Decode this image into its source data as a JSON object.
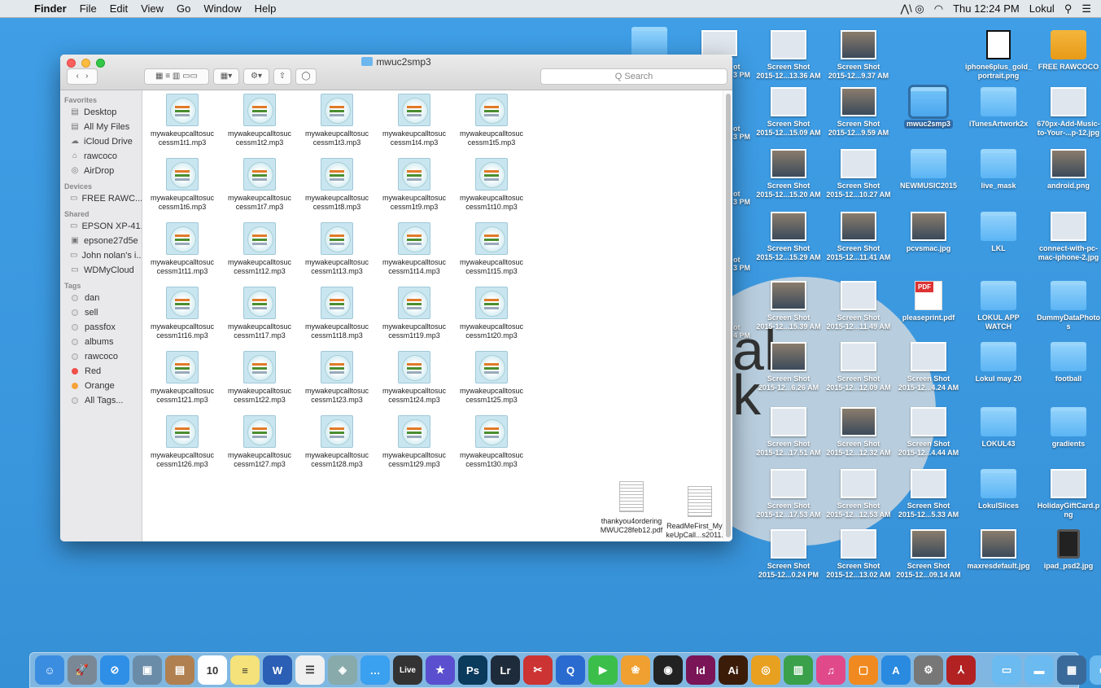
{
  "menubar": {
    "apple": "",
    "items": [
      "Finder",
      "File",
      "Edit",
      "View",
      "Go",
      "Window",
      "Help"
    ],
    "clock": "Thu 12:24 PM",
    "user": "Lokul"
  },
  "window": {
    "title": "mwuc2smp3",
    "search_placeholder": "Q Search"
  },
  "sidebar": {
    "favorites_header": "Favorites",
    "favorites": [
      "Desktop",
      "All My Files",
      "iCloud Drive",
      "rawcoco",
      "AirDrop"
    ],
    "devices_header": "Devices",
    "devices": [
      "FREE RAWC... ≜"
    ],
    "shared_header": "Shared",
    "shared": [
      "EPSON XP-41...",
      "epsone27d5e",
      "John nolan's i...",
      "WDMyCloud"
    ],
    "tags_header": "Tags",
    "tags": [
      {
        "label": "dan",
        "color": "#dddddd"
      },
      {
        "label": "sell",
        "color": "#dddddd"
      },
      {
        "label": "passfox",
        "color": "#dddddd"
      },
      {
        "label": "albums",
        "color": "#dddddd"
      },
      {
        "label": "rawcoco",
        "color": "#dddddd"
      },
      {
        "label": "Red",
        "color": "#f0504a"
      },
      {
        "label": "Orange",
        "color": "#f6a33a"
      },
      {
        "label": "All Tags...",
        "color": "#dddddd"
      }
    ]
  },
  "files": [
    {
      "l1": "mywakeupcalltosuc",
      "l2": "cessm1t1.mp3"
    },
    {
      "l1": "mywakeupcalltosuc",
      "l2": "cessm1t2.mp3"
    },
    {
      "l1": "mywakeupcalltosuc",
      "l2": "cessm1t3.mp3"
    },
    {
      "l1": "mywakeupcalltosuc",
      "l2": "cessm1t4.mp3"
    },
    {
      "l1": "mywakeupcalltosuc",
      "l2": "cessm1t5.mp3"
    },
    {
      "l1": "mywakeupcalltosuc",
      "l2": "cessm1t6.mp3"
    },
    {
      "l1": "mywakeupcalltosuc",
      "l2": "cessm1t7.mp3"
    },
    {
      "l1": "mywakeupcalltosuc",
      "l2": "cessm1t8.mp3"
    },
    {
      "l1": "mywakeupcalltosuc",
      "l2": "cessm1t9.mp3"
    },
    {
      "l1": "mywakeupcalltosuc",
      "l2": "cessm1t10.mp3"
    },
    {
      "l1": "mywakeupcalltosuc",
      "l2": "cessm1t11.mp3"
    },
    {
      "l1": "mywakeupcalltosuc",
      "l2": "cessm1t12.mp3"
    },
    {
      "l1": "mywakeupcalltosuc",
      "l2": "cessm1t13.mp3"
    },
    {
      "l1": "mywakeupcalltosuc",
      "l2": "cessm1t14.mp3"
    },
    {
      "l1": "mywakeupcalltosuc",
      "l2": "cessm1t15.mp3"
    },
    {
      "l1": "mywakeupcalltosuc",
      "l2": "cessm1t16.mp3"
    },
    {
      "l1": "mywakeupcalltosuc",
      "l2": "cessm1t17.mp3"
    },
    {
      "l1": "mywakeupcalltosuc",
      "l2": "cessm1t18.mp3"
    },
    {
      "l1": "mywakeupcalltosuc",
      "l2": "cessm1t19.mp3"
    },
    {
      "l1": "mywakeupcalltosuc",
      "l2": "cessm1t20.mp3"
    },
    {
      "l1": "mywakeupcalltosuc",
      "l2": "cessm1t21.mp3"
    },
    {
      "l1": "mywakeupcalltosuc",
      "l2": "cessm1t22.mp3"
    },
    {
      "l1": "mywakeupcalltosuc",
      "l2": "cessm1t23.mp3"
    },
    {
      "l1": "mywakeupcalltosuc",
      "l2": "cessm1t24.mp3"
    },
    {
      "l1": "mywakeupcalltosuc",
      "l2": "cessm1t25.mp3"
    },
    {
      "l1": "mywakeupcalltosuc",
      "l2": "cessm1t26.mp3"
    },
    {
      "l1": "mywakeupcalltosuc",
      "l2": "cessm1t27.mp3"
    },
    {
      "l1": "mywakeupcalltosuc",
      "l2": "cessm1t28.mp3"
    },
    {
      "l1": "mywakeupcalltosuc",
      "l2": "cessm1t29.mp3"
    },
    {
      "l1": "mywakeupcalltosuc",
      "l2": "cessm1t30.mp3"
    }
  ],
  "pdfs": [
    {
      "l1": "thankyou4ordering",
      "l2": "MWUC28feb12.pdf"
    },
    {
      "l1": "ReadMeFirst_MyWa",
      "l2": "keUpCall...s2011.pdf"
    }
  ],
  "desktop_icons": [
    {
      "l1": "Screen Shot",
      "l2": "2015-12...13.36 AM",
      "kind": "shot"
    },
    {
      "l1": "Screen Shot",
      "l2": "2015-12...9.37 AM",
      "kind": "shot dark"
    },
    {
      "l1": "iphone6plus_gold_",
      "l2": "portrait.png",
      "kind": "phone"
    },
    {
      "l1": "FREE RAWCOCO",
      "l2": "",
      "kind": "drive"
    },
    {
      "l1": "Screen Shot",
      "l2": "2015-12...15.09 AM",
      "kind": "shot"
    },
    {
      "l1": "Screen Shot",
      "l2": "2015-12...9.59 AM",
      "kind": "shot dark"
    },
    {
      "l1": "mwuc2smp3",
      "l2": "",
      "kind": "folder selected"
    },
    {
      "l1": "iTunesArtwork2x",
      "l2": "",
      "kind": "folder"
    },
    {
      "l1": "670px-Add-Music-",
      "l2": "to-Your-...p-12.jpg",
      "kind": "shot"
    },
    {
      "l1": "Screen Shot",
      "l2": "2015-12...15.20 AM",
      "kind": "shot dark"
    },
    {
      "l1": "Screen Shot",
      "l2": "2015-12...10.27 AM",
      "kind": "shot"
    },
    {
      "l1": "NEWMUSIC2015",
      "l2": "",
      "kind": "folder"
    },
    {
      "l1": "live_mask",
      "l2": "",
      "kind": "folder"
    },
    {
      "l1": "android.png",
      "l2": "",
      "kind": "shot dark"
    },
    {
      "l1": "Screen Shot",
      "l2": "2015-12...15.29 AM",
      "kind": "shot dark"
    },
    {
      "l1": "Screen Shot",
      "l2": "2015-12...11.41 AM",
      "kind": "shot dark"
    },
    {
      "l1": "pcvsmac.jpg",
      "l2": "",
      "kind": "shot dark"
    },
    {
      "l1": "LKL",
      "l2": "",
      "kind": "folder"
    },
    {
      "l1": "connect-with-pc-",
      "l2": "mac-iphone-2.jpg",
      "kind": "shot"
    },
    {
      "l1": "Screen Shot",
      "l2": "2015-12...15.39 AM",
      "kind": "shot dark"
    },
    {
      "l1": "Screen Shot",
      "l2": "2015-12...11.49 AM",
      "kind": "shot"
    },
    {
      "l1": "pleaseprint.pdf",
      "l2": "",
      "kind": "pdf"
    },
    {
      "l1": "LOKUL APP",
      "l2": "WATCH",
      "kind": "folder"
    },
    {
      "l1": "DummyDataPhoto",
      "l2": "s",
      "kind": "folder"
    },
    {
      "l1": "Screen Shot",
      "l2": "2015-12...6.26 AM",
      "kind": "shot dark"
    },
    {
      "l1": "Screen Shot",
      "l2": "2015-12...12.09 AM",
      "kind": "shot"
    },
    {
      "l1": "Screen Shot",
      "l2": "2015-12...4.24 AM",
      "kind": "shot"
    },
    {
      "l1": "Lokul may 20",
      "l2": "",
      "kind": "folder"
    },
    {
      "l1": "football",
      "l2": "",
      "kind": "folder"
    },
    {
      "l1": "Screen Shot",
      "l2": "2015-12...17.51 AM",
      "kind": "shot"
    },
    {
      "l1": "Screen Shot",
      "l2": "2015-12...12.32 AM",
      "kind": "shot dark"
    },
    {
      "l1": "Screen Shot",
      "l2": "2015-12...4.44 AM",
      "kind": "shot"
    },
    {
      "l1": "LOKUL43",
      "l2": "",
      "kind": "folder"
    },
    {
      "l1": "gradients",
      "l2": "",
      "kind": "folder"
    },
    {
      "l1": "Screen Shot",
      "l2": "2015-12...17.53 AM",
      "kind": "shot"
    },
    {
      "l1": "Screen Shot",
      "l2": "2015-12...12.53 AM",
      "kind": "shot"
    },
    {
      "l1": "Screen Shot",
      "l2": "2015-12...5.33 AM",
      "kind": "shot"
    },
    {
      "l1": "LokulSlices",
      "l2": "",
      "kind": "folder"
    },
    {
      "l1": "HolidayGiftCard.p",
      "l2": "ng",
      "kind": "shot"
    },
    {
      "l1": "Screen Shot",
      "l2": "2015-12...0.24 PM",
      "kind": "shot"
    },
    {
      "l1": "Screen Shot",
      "l2": "2015-12...13.02 AM",
      "kind": "shot"
    },
    {
      "l1": "Screen Shot",
      "l2": "2015-12...09.14 AM",
      "kind": "shot dark"
    },
    {
      "l1": "maxresdefault.jpg",
      "l2": "",
      "kind": "shot dark"
    },
    {
      "l1": "ipad_psd2.jpg",
      "l2": "",
      "kind": "ipad"
    }
  ],
  "partial_labels": [
    "ot",
    "3 PM",
    "ot",
    "3 PM",
    "ot",
    "3 PM",
    "ot",
    "3 PM",
    "ot",
    "4 PM"
  ],
  "dock": [
    {
      "name": "finder-icon",
      "glyph": "☺",
      "color": "#3b8de0"
    },
    {
      "name": "launchpad-icon",
      "glyph": "🚀",
      "color": "#7a8896"
    },
    {
      "name": "safari-icon",
      "glyph": "⊘",
      "color": "#2f8fe6"
    },
    {
      "name": "preview-icon",
      "glyph": "▣",
      "color": "#6b8ca8"
    },
    {
      "name": "contacts-icon",
      "glyph": "▤",
      "color": "#b08050"
    },
    {
      "name": "calendar-icon",
      "glyph": "10",
      "color": "#ffffff"
    },
    {
      "name": "notes-icon",
      "glyph": "≡",
      "color": "#f5e27a"
    },
    {
      "name": "word-icon",
      "glyph": "W",
      "color": "#2b5fb5"
    },
    {
      "name": "reminders-icon",
      "glyph": "☰",
      "color": "#f0f0f0"
    },
    {
      "name": "imagecapture-icon",
      "glyph": "◈",
      "color": "#8aa"
    },
    {
      "name": "messages-icon",
      "glyph": "…",
      "color": "#3aa0f0"
    },
    {
      "name": "live-icon",
      "glyph": "Live",
      "color": "#333333"
    },
    {
      "name": "imovie-icon",
      "glyph": "★",
      "color": "#5a4fcf"
    },
    {
      "name": "photoshop-icon",
      "glyph": "Ps",
      "color": "#0a3a5c"
    },
    {
      "name": "lightroom-icon",
      "glyph": "Lr",
      "color": "#1e2b3a"
    },
    {
      "name": "photobooth-icon",
      "glyph": "✂",
      "color": "#c33"
    },
    {
      "name": "quicktime-icon",
      "glyph": "Q",
      "color": "#2a6bd0"
    },
    {
      "name": "facetime-icon",
      "glyph": "▶",
      "color": "#3bbf4a"
    },
    {
      "name": "photos-icon",
      "glyph": "❀",
      "color": "#f0a030"
    },
    {
      "name": "logic-icon",
      "glyph": "◉",
      "color": "#222222"
    },
    {
      "name": "indesign-icon",
      "glyph": "Id",
      "color": "#7a1558"
    },
    {
      "name": "illustrator-icon",
      "glyph": "Ai",
      "color": "#3a1c08"
    },
    {
      "name": "chrome-icon",
      "glyph": "◎",
      "color": "#e8a020"
    },
    {
      "name": "numbers-icon",
      "glyph": "▥",
      "color": "#3aa04a"
    },
    {
      "name": "itunes-icon",
      "glyph": "♫",
      "color": "#e04a8a"
    },
    {
      "name": "ibooks-icon",
      "glyph": "▢",
      "color": "#f08a20"
    },
    {
      "name": "appstore-icon",
      "glyph": "A",
      "color": "#2a8ae0"
    },
    {
      "name": "sysprefs-icon",
      "glyph": "⚙",
      "color": "#777777"
    },
    {
      "name": "acrobat-icon",
      "glyph": "⅄",
      "color": "#b22222"
    },
    {
      "name": "downloads-folder-icon",
      "glyph": "▭",
      "color": "#6bbaf0"
    },
    {
      "name": "stack-icon",
      "glyph": "▬",
      "color": "#6bbaf0"
    },
    {
      "name": "psd-stack-icon",
      "glyph": "▦",
      "color": "#3a6a9a"
    },
    {
      "name": "documents-stack-icon",
      "glyph": "▭",
      "color": "#6bbaf0"
    },
    {
      "name": "trash-icon",
      "glyph": "🗑",
      "color": "#c8d0d8"
    }
  ]
}
